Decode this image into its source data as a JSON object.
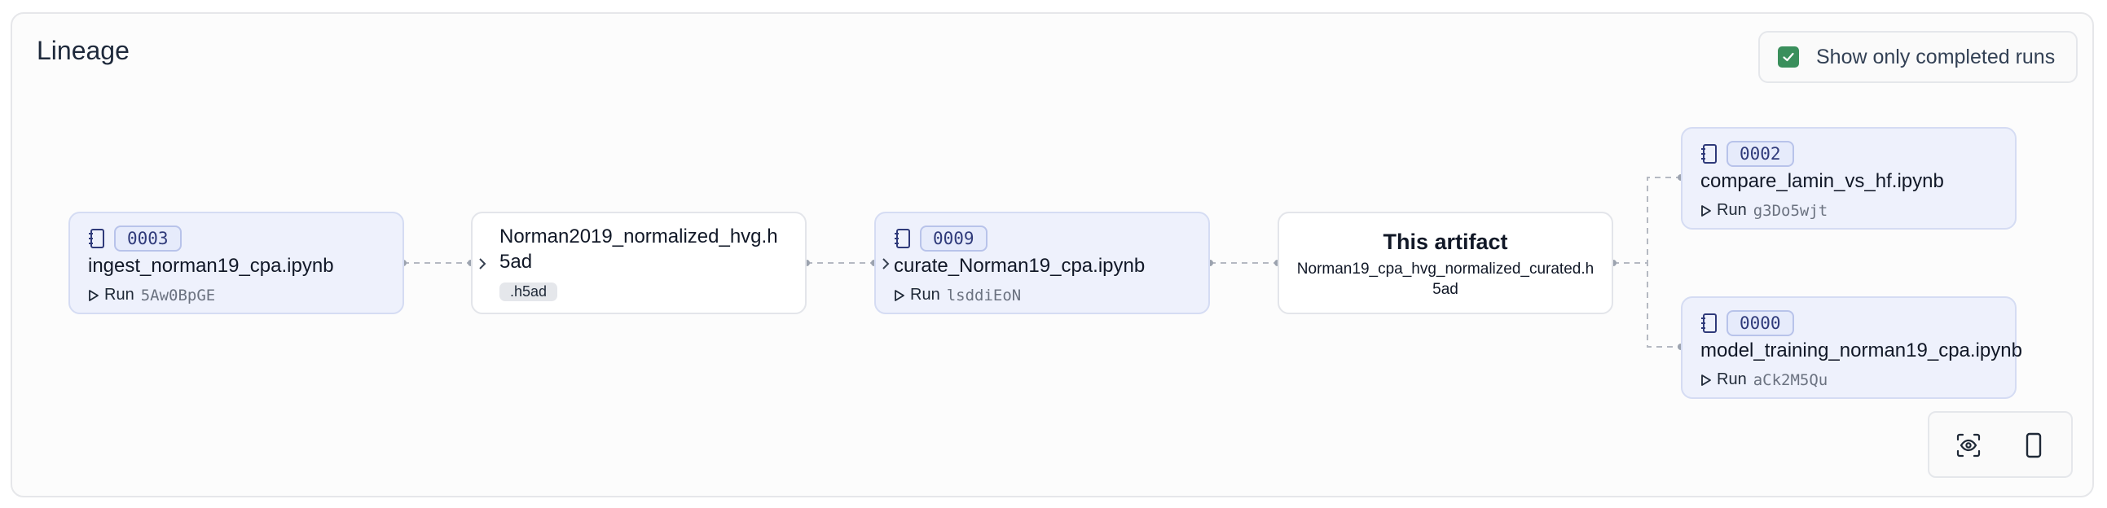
{
  "header": {
    "title": "Lineage"
  },
  "toggle": {
    "label": "Show only completed runs",
    "checked": true
  },
  "run_prefix": "Run",
  "nodes": {
    "ingest": {
      "number": "0003",
      "name": "ingest_norman19_cpa.ipynb",
      "run_id": "5Aw0BpGE"
    },
    "norman2019": {
      "name": "Norman2019_normalized_hvg.h5ad",
      "suffix": ".h5ad"
    },
    "curate": {
      "number": "0009",
      "name": "curate_Norman19_cpa.ipynb",
      "run_id": "lsddiEoN"
    },
    "current": {
      "title": "This artifact",
      "name": "Norman19_cpa_hvg_normalized_curated.h5ad"
    },
    "compare": {
      "number": "0002",
      "name": "compare_lamin_vs_hf.ipynb",
      "run_id": "g3Do5wjt"
    },
    "model": {
      "number": "0000",
      "name": "model_training_norman19_cpa.ipynb",
      "run_id": "aCk2M5Qu"
    }
  },
  "colors": {
    "accent": "#3a8f5c",
    "notebook_bg": "#eef1fc",
    "badge_border": "#b8c3ea"
  },
  "icons": {
    "notebook": "notebook-icon",
    "run": "play-outline-icon",
    "expand": "chevron-right-icon",
    "fit_view": "eye-focus-icon",
    "layout": "phone-frame-icon"
  }
}
